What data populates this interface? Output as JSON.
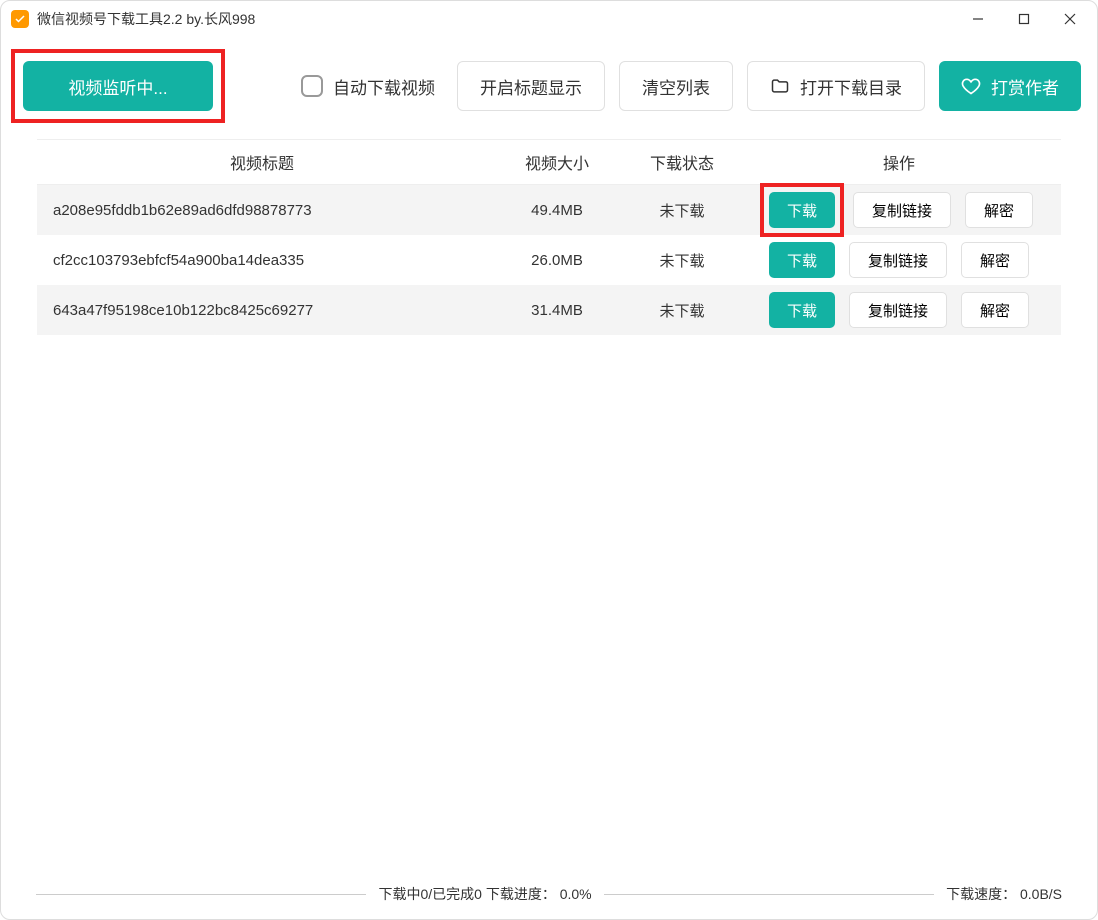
{
  "title": "微信视频号下载工具2.2 by.长风998",
  "toolbar": {
    "monitor_label": "视频监听中...",
    "auto_download_label": "自动下载视频",
    "show_title_label": "开启标题显示",
    "clear_list_label": "清空列表",
    "open_folder_label": "打开下载目录",
    "donate_label": "打赏作者"
  },
  "table": {
    "headers": {
      "title": "视频标题",
      "size": "视频大小",
      "status": "下载状态",
      "action": "操作"
    },
    "action_labels": {
      "download": "下载",
      "copy_link": "复制链接",
      "decrypt": "解密"
    },
    "rows": [
      {
        "title": "a208e95fddb1b62e89ad6dfd98878773",
        "size": "49.4MB",
        "status": "未下载"
      },
      {
        "title": "cf2cc103793ebfcf54a900ba14dea335",
        "size": "26.0MB",
        "status": "未下载"
      },
      {
        "title": "643a47f95198ce10b122bc8425c69277",
        "size": "31.4MB",
        "status": "未下载"
      }
    ]
  },
  "statusbar": {
    "progress_text": "下载中0/已完成0  下载进度： 0.0%",
    "speed_text": "下载速度： 0.0B/S"
  }
}
